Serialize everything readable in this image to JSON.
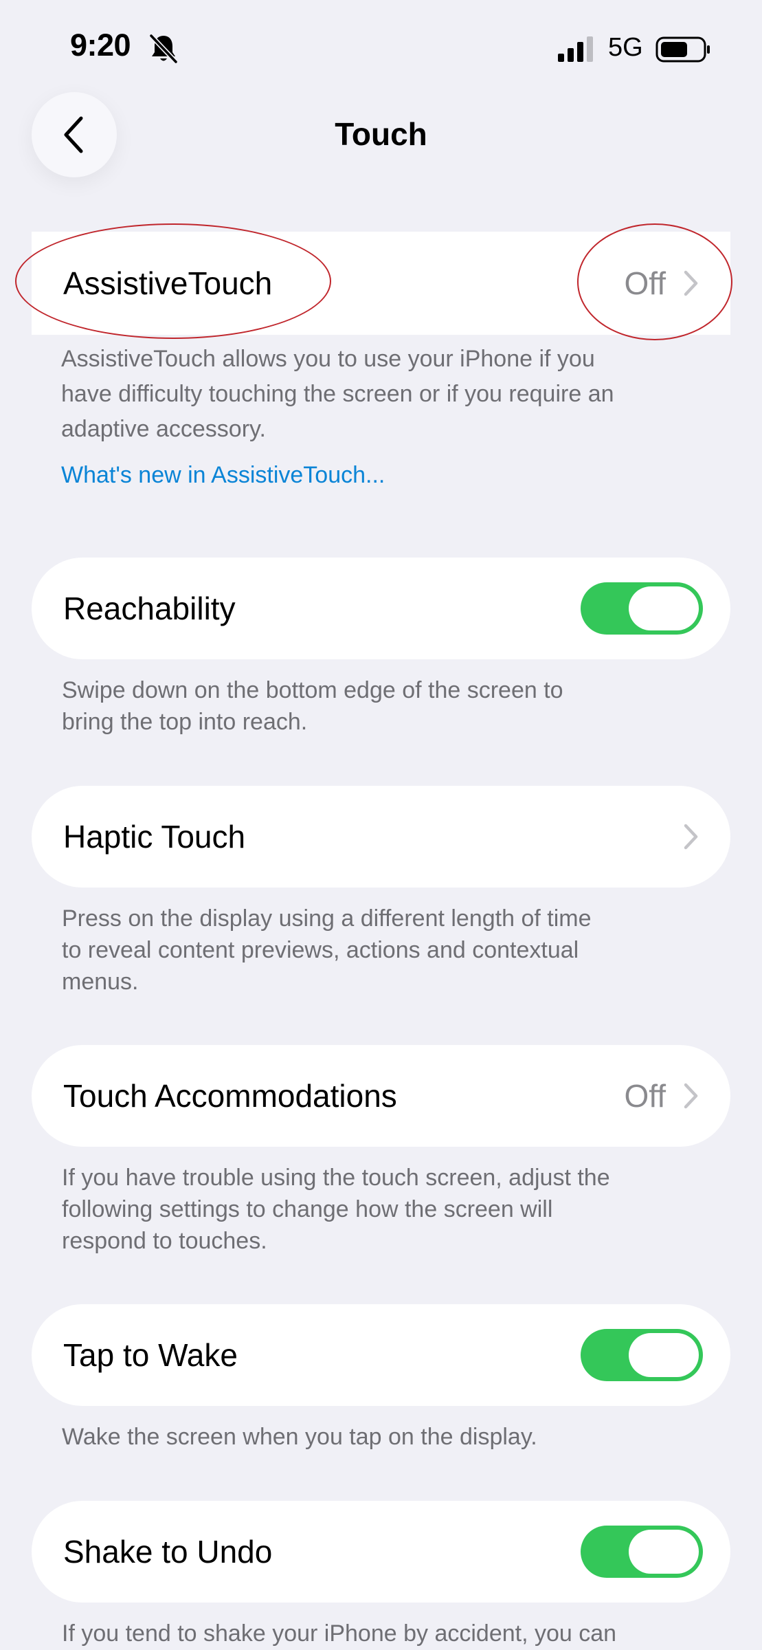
{
  "status_bar": {
    "time": "9:20",
    "network": "5G",
    "icons": [
      "bell-slash-icon",
      "signal-bars-icon",
      "battery-icon"
    ]
  },
  "nav": {
    "title": "Touch",
    "back_icon": "chevron-left-icon"
  },
  "sections": {
    "assistive_touch": {
      "label": "AssistiveTouch",
      "value": "Off",
      "footer_lines": [
        "AssistiveTouch allows you to use your iPhone if you",
        "have difficulty touching the screen or if you require an",
        "adaptive accessory."
      ],
      "link": "What's new in AssistiveTouch..."
    },
    "reachability": {
      "label": "Reachability",
      "toggle_on": true,
      "footer_lines": [
        "Swipe down on the bottom edge of the screen to",
        "bring the top into reach."
      ]
    },
    "haptic_touch": {
      "label": "Haptic Touch",
      "footer_lines": [
        "Press on the display using a different length of time",
        "to reveal content previews, actions and contextual",
        "menus."
      ]
    },
    "touch_accommodations": {
      "label": "Touch Accommodations",
      "value": "Off",
      "footer_lines": [
        "If you have trouble using the touch screen, adjust the",
        "following settings to change how the screen will",
        "respond to touches."
      ]
    },
    "tap_to_wake": {
      "label": "Tap to Wake",
      "toggle_on": true,
      "footer_lines": [
        "Wake the screen when you tap on the display."
      ]
    },
    "shake_to_undo": {
      "label": "Shake to Undo",
      "toggle_on": true,
      "footer_lines": [
        "If you tend to shake your iPhone by accident, you can"
      ]
    }
  },
  "colors": {
    "background": "#f0f0f6",
    "toggle_on": "#34c759",
    "link": "#0a84d6",
    "secondary_text": "#6e6e73",
    "annotation": "#c0262c"
  }
}
